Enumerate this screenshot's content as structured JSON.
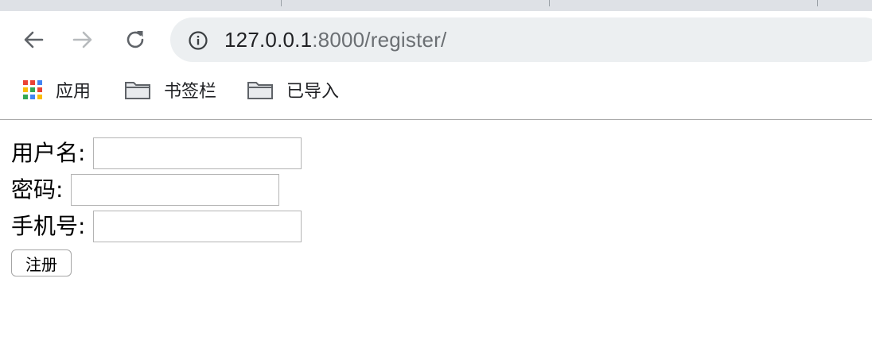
{
  "browser": {
    "nav": {
      "back_icon": "arrow-left-icon",
      "forward_icon": "arrow-right-icon",
      "reload_icon": "reload-icon"
    },
    "address": {
      "info_icon": "info-icon",
      "host": "127.0.0.1",
      "path": ":8000/register/"
    },
    "bookmarks": [
      {
        "label": "应用",
        "icon": "apps-grid-icon"
      },
      {
        "label": "书签栏",
        "icon": "folder-icon"
      },
      {
        "label": "已导入",
        "icon": "folder-icon"
      }
    ],
    "colors": {
      "tabstrip": "#dee1e6",
      "omnibox": "#eceff1",
      "apps_grid": [
        "#ea4335",
        "#fbbc05",
        "#34a853",
        "#4285f4"
      ]
    }
  },
  "form": {
    "username_label": "用户名:",
    "username_value": "",
    "password_label": "密码:",
    "password_value": "",
    "phone_label": "手机号:",
    "phone_value": "",
    "submit_label": "注册"
  }
}
